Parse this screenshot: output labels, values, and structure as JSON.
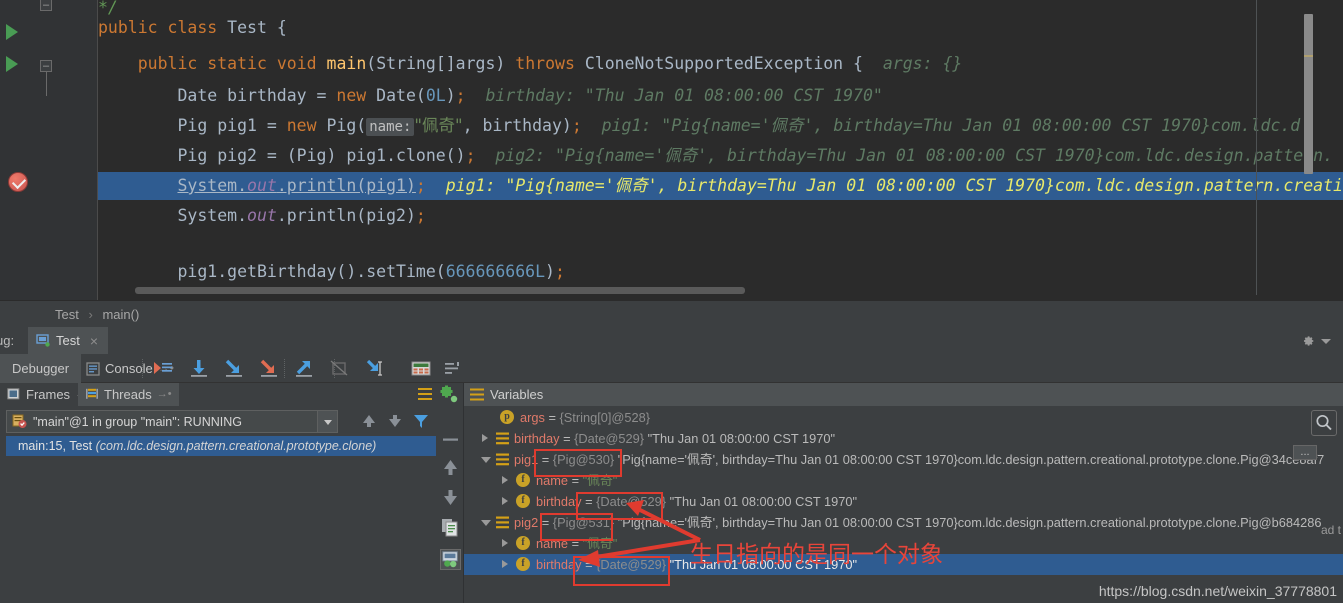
{
  "editor": {
    "lines": [
      {
        "id": "l0",
        "text": "*/"
      },
      {
        "id": "l1",
        "text": "public class Test {"
      },
      {
        "id": "l2",
        "text": "public static void main(String[]args) throws CloneNotSupportedException {",
        "hint": "args:  {}"
      },
      {
        "id": "l3",
        "text": "Date birthday = new Date(0L);",
        "hint": "birthday:  \"Thu Jan 01 08:00:00 CST 1970\""
      },
      {
        "id": "l4",
        "text": "Pig pig1 = new Pig( name: \"佩奇\", birthday);",
        "hint": "pig1:  \"Pig{name='佩奇', birthday=Thu Jan 01 08:00:00 CST 1970}com.ldc.d"
      },
      {
        "id": "l5",
        "text": "Pig pig2 = (Pig) pig1.clone();",
        "hint": "pig2:  \"Pig{name='佩奇', birthday=Thu Jan 01 08:00:00 CST 1970}com.ldc.design.pattern."
      },
      {
        "id": "l6",
        "text": "System.out.println(pig1);",
        "hint": "pig1:  \"Pig{name='佩奇', birthday=Thu Jan 01 08:00:00 CST 1970}com.ldc.design.pattern.creati"
      },
      {
        "id": "l7",
        "text": "System.out.println(pig2);"
      },
      {
        "id": "l8",
        "text": "pig1.getBirthday().setTime(666666666L);"
      }
    ],
    "param_hint_name": "name:",
    "string_peiqi": "\"佩奇\"",
    "setTime_arg": "666666666L",
    "date_arg": "0L"
  },
  "breadcrumb": {
    "class": "Test",
    "method": "main()"
  },
  "debug_window": {
    "label": "ug:",
    "run_tab": "Test",
    "close_x": "×",
    "tabs": {
      "debugger": "Debugger",
      "console": "Console"
    },
    "toolbar_icons": [
      "show-execution-point-icon",
      "step-over-icon",
      "step-into-icon",
      "force-step-into-icon",
      "step-out-icon",
      "drop-frame-icon",
      "run-to-cursor-icon",
      "evaluate-expression-icon",
      "layout-icon"
    ],
    "gear_icon": "settings-gear-icon"
  },
  "frames": {
    "frames_tab": "Frames",
    "threads_tab": "Threads",
    "thread_selector": "\"main\"@1 in group \"main\": RUNNING",
    "stack_entry": {
      "location": "main:15, Test",
      "package": "(com.ldc.design.pattern.creational.prototype.clone)"
    }
  },
  "variables": {
    "title": "Variables",
    "rows": [
      {
        "id": "v0",
        "indent": 2,
        "arrow": "none",
        "icon": "param",
        "name": "args",
        "eq": " = ",
        "ref": "{String[0]@528}",
        "str": "",
        "tail": "",
        "selected": false
      },
      {
        "id": "v1",
        "indent": 1,
        "arrow": "closed",
        "icon": "object",
        "name": "birthday",
        "eq": " = ",
        "ref": "{Date@529}",
        "str": " \"Thu Jan 01 08:00:00 CST 1970\"",
        "tail": "",
        "selected": false
      },
      {
        "id": "v2",
        "indent": 1,
        "arrow": "open",
        "icon": "object",
        "name": "pig1",
        "eq": " = ",
        "ref": "{Pig@530}",
        "str": " \"Pig{name='佩奇', birthday=Thu Jan 01 08:00:00 CST 1970}com.ldc.design.pattern.creational.prototype.clone.Pig@34ce8af7",
        "tail": "",
        "selected": false
      },
      {
        "id": "v3",
        "indent": 2,
        "arrow": "closed",
        "icon": "field",
        "name": "name",
        "eq": " = ",
        "ref": "",
        "str": "\"佩奇\"",
        "tail": "",
        "selected": false
      },
      {
        "id": "v4",
        "indent": 2,
        "arrow": "closed",
        "icon": "field",
        "name": "birthday",
        "eq": " = ",
        "ref": "{Date@529}",
        "str": " \"Thu Jan 01 08:00:00 CST 1970\"",
        "tail": "",
        "selected": false
      },
      {
        "id": "v5",
        "indent": 1,
        "arrow": "open",
        "icon": "object",
        "name": "pig2",
        "eq": " = ",
        "ref": "{Pig@531}",
        "str": " \"Pig{name='佩奇', birthday=Thu Jan 01 08:00:00 CST 1970}com.ldc.design.pattern.creational.prototype.clone.Pig@b684286",
        "tail": "",
        "selected": false
      },
      {
        "id": "v6",
        "indent": 2,
        "arrow": "closed",
        "icon": "field",
        "name": "name",
        "eq": " = ",
        "ref": "",
        "str": "\"佩奇\"",
        "tail": "",
        "selected": false
      },
      {
        "id": "v7",
        "indent": 2,
        "arrow": "closed",
        "icon": "field",
        "name": "birthday",
        "eq": " = ",
        "ref": "{Date@529}",
        "str": " \"Thu Jan 01 08:00:00 CST 1970\"",
        "tail": "",
        "selected": true
      }
    ],
    "search_icon": "search-icon",
    "dots_button": "...",
    "load_text": "ad t"
  },
  "annotation": {
    "text": "生日指向的是同一个对象",
    "color": "#e8453a",
    "boxes": [
      "pig1-ref-box",
      "pig1-birthday-ref-box",
      "pig2-ref-box",
      "pig2-birthday-ref-box"
    ]
  },
  "watermark": "https://blog.csdn.net/weixin_37778801"
}
